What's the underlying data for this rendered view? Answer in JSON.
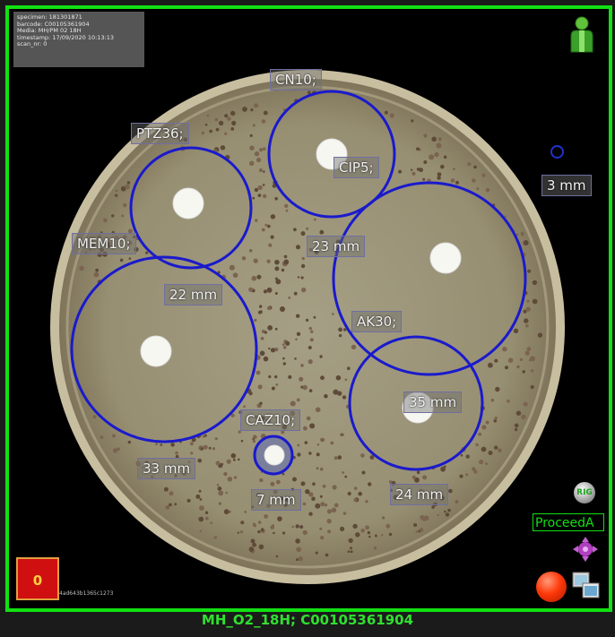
{
  "metadata": {
    "lines": [
      "specimen: 181301871",
      "barcode: C00105361904",
      "Media: MH/PM 02 18H",
      "timestamp: 17/09/2020 10:13:13",
      "scan_nr: 0"
    ]
  },
  "disks": [
    {
      "code": "CN10;",
      "zone": ""
    },
    {
      "code": "CIP5;",
      "zone": "23 mm"
    },
    {
      "code": "PTZ36;",
      "zone": "22 mm"
    },
    {
      "code": "MEM10;",
      "zone": "33 mm"
    },
    {
      "code": "AK30;",
      "zone": "35 mm"
    },
    {
      "code": "CAZ10;",
      "zone": "7 mm"
    },
    {
      "code": "",
      "zone": "24 mm"
    }
  ],
  "reference": {
    "zone": "3 mm"
  },
  "controls": {
    "rig_label": "RIG",
    "proceed_label": "ProceedA",
    "counter_value": "0",
    "code_text": "4ad643b1365c1273"
  },
  "footer": {
    "text": "MH_O2_18H; C00105361904"
  },
  "colors": {
    "frame": "#12e012",
    "zone_circle": "#1a1acc",
    "record": "#ff3a0a"
  },
  "icons": {
    "user": "person-icon",
    "navigate": "four-way-arrow-icon",
    "windows": "windows-icon",
    "record": "record-icon"
  }
}
